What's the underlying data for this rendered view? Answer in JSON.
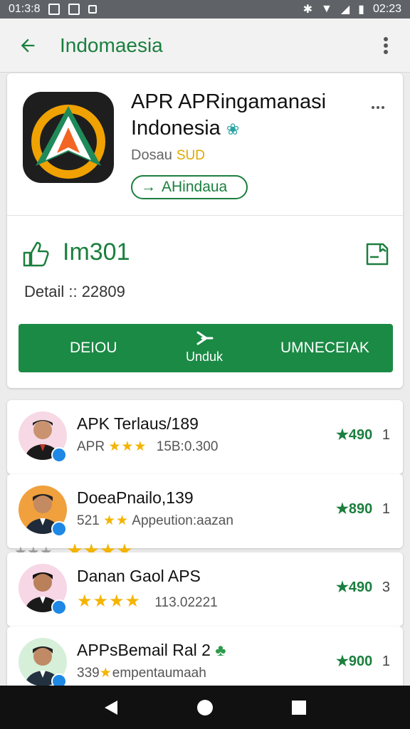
{
  "status_bar": {
    "time_left": "01:3:8",
    "time_right": "02:23"
  },
  "app_bar": {
    "title": "Indomaesia"
  },
  "app": {
    "name_line1": "APR APRingamanasi",
    "name_line2": "Indonesia",
    "developer": "Dosau",
    "developer_badge": "SUD",
    "install_label": "AHindaua",
    "stat_value": "Im301",
    "detail": "Detail :: 22809"
  },
  "actions": {
    "left_label": "DEIOU",
    "center_label": "Unduk",
    "right_label": "UMNECEIAK"
  },
  "list": [
    {
      "title": "APK Terlaus/189",
      "sub_prefix": "APR",
      "stars": "★★★",
      "sub_text": "15B:0.300",
      "score": "★490",
      "trail": "1"
    },
    {
      "title": "DoeaPnailo,139",
      "sub_prefix": "521",
      "stars": "★★",
      "sub_text": "Appeution:aazan",
      "score": "★890",
      "trail": "1"
    },
    {
      "title": "Danan Gaol APS",
      "sub_prefix": "",
      "stars": "★★★★",
      "sub_text": "113.02221",
      "score": "★490",
      "trail": "3"
    },
    {
      "title": "APPsBemail Ral 2",
      "sub_prefix": "339",
      "stars": "★",
      "sub_text": "empentaumaah",
      "score": "★900",
      "trail": "1"
    }
  ],
  "stars_strip": {
    "grey": "★★★",
    "gold": "★★★★"
  },
  "colors": {
    "brand_green": "#1b8a45",
    "star_gold": "#f4b400",
    "badge_blue": "#1e88e5"
  }
}
